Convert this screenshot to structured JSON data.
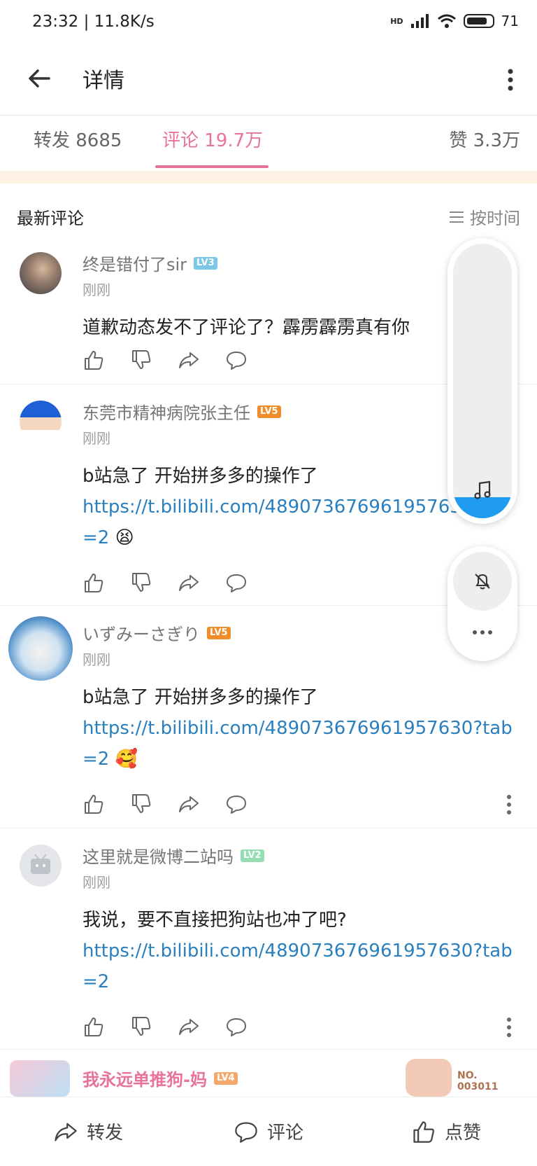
{
  "status_bar": {
    "time": "23:32 | 11.8K/s",
    "network": "HD",
    "battery": "71"
  },
  "toolbar": {
    "title": "详情"
  },
  "tabs": {
    "forward": "转发 8685",
    "comment": "评论 19.7万",
    "like": "赞 3.3万"
  },
  "section": {
    "title": "最新评论",
    "sort_label": "按时间"
  },
  "comments": [
    {
      "user": "终是错付了sir",
      "level": "LV3",
      "level_color": "#7cc6e8",
      "time": "刚刚",
      "text": "道歉动态发不了评论了？霹雳霹雳真有你",
      "link": "",
      "emoji": ""
    },
    {
      "user": "东莞市精神病院张主任",
      "level": "LV5",
      "level_color": "#f08c2a",
      "time": "刚刚",
      "text": "b站急了 开始拼多多的操作了",
      "link": "https://t.bilibili.com/48907367696195763",
      "link_tail": "=2",
      "emoji": "😫"
    },
    {
      "user": "いずみーさぎり",
      "level": "LV5",
      "level_color": "#f08c2a",
      "time": "刚刚",
      "text": "b站急了 开始拼多多的操作了",
      "link": "https://t.bilibili.com/489073676961957630?tab",
      "link_tail": "=2",
      "emoji": "🥰"
    },
    {
      "user": "这里就是微博二站吗",
      "level": "LV2",
      "level_color": "#95ddb2",
      "time": "刚刚",
      "text": "我说，要不直接把狗站也冲了吧?",
      "link": "https://t.bilibili.com/489073676961957630?tab",
      "link_tail": "=2",
      "emoji": ""
    }
  ],
  "peek": {
    "user": "我永远单推狗-妈",
    "level": "LV4",
    "level_color": "#f3a86a",
    "badge_text": "NO. 003011"
  },
  "bottom": {
    "forward": "转发",
    "comment": "评论",
    "like": "点赞"
  },
  "icons": [
    "back-arrow-icon",
    "more-vertical-icon",
    "menu-lines-icon",
    "thumb-up-icon",
    "thumb-down-icon",
    "share-icon",
    "comment-icon",
    "music-note-icon",
    "bell-off-icon",
    "more-horizontal-icon"
  ],
  "colors": {
    "accent": "#e8739a",
    "link": "#2a7fbf",
    "float_fill": "#1f9cf0"
  }
}
